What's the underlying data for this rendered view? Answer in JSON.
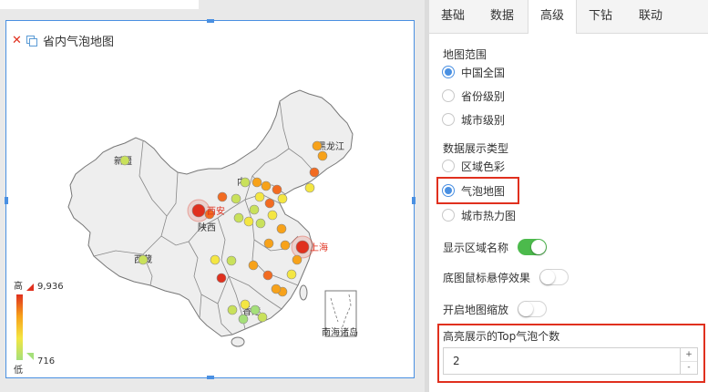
{
  "widget": {
    "title": "省内气泡地图",
    "close_icon": "close-icon",
    "copy_icon": "copy-icon"
  },
  "map": {
    "region_labels": {
      "heilongjiang": "黑龙江",
      "nei": "内",
      "xinjiang": "新疆",
      "xizang": "西藏",
      "shaanxi": "陕西",
      "nanhai": "南海诸岛",
      "hong_kong": "香港"
    },
    "city_labels": {
      "shanghai": "上海",
      "xian": "西安"
    },
    "bubble_colors": [
      "#e0301e",
      "#f26b21",
      "#f7a21a",
      "#f4e642",
      "#c9e15b",
      "#a5e07a"
    ]
  },
  "legend": {
    "high_label": "高",
    "low_label": "低",
    "max_value": "9,936",
    "min_value": "716"
  },
  "panel": {
    "tabs": [
      {
        "label": "基础",
        "active": false
      },
      {
        "label": "数据",
        "active": false
      },
      {
        "label": "高级",
        "active": true
      },
      {
        "label": "下钻",
        "active": false
      },
      {
        "label": "联动",
        "active": false
      }
    ],
    "map_range": {
      "label": "地图范围",
      "options": [
        {
          "label": "中国全国",
          "checked": true
        },
        {
          "label": "省份级别",
          "checked": false
        },
        {
          "label": "城市级别",
          "checked": false
        }
      ]
    },
    "display_type": {
      "label": "数据展示类型",
      "options": [
        {
          "label": "区域色彩",
          "checked": false
        },
        {
          "label": "气泡地图",
          "checked": true
        },
        {
          "label": "城市热力图",
          "checked": false
        }
      ]
    },
    "toggles": [
      {
        "label": "显示区域名称",
        "on": true
      },
      {
        "label": "底图鼠标悬停效果",
        "on": false
      },
      {
        "label": "开启地图缩放",
        "on": false
      }
    ],
    "topn": {
      "label": "高亮展示的Top气泡个数",
      "value": "2",
      "up": "+",
      "down": "-"
    }
  },
  "colors": {
    "accent": "#4a90e2",
    "highlight": "#e0301e",
    "toggle_on": "#4cba4c",
    "map_fill": "#eeeeee",
    "map_stroke": "#777777"
  }
}
